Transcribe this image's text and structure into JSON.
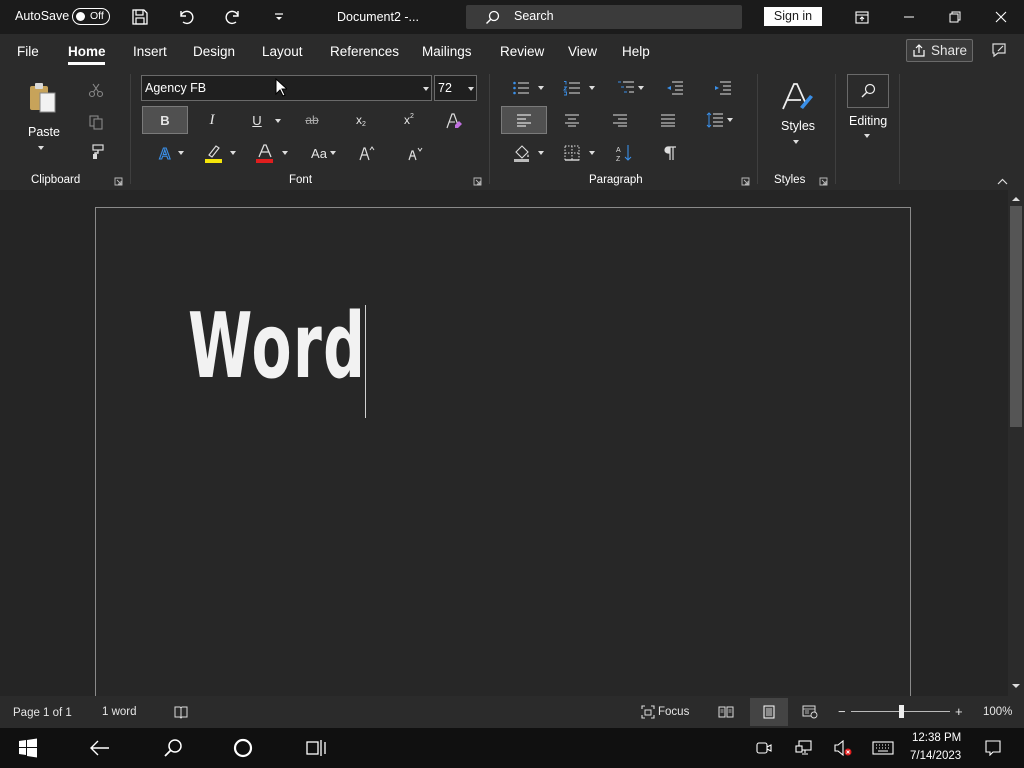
{
  "title_bar": {
    "autosave_label": "AutoSave",
    "autosave_state": "Off",
    "doc_title": "Document2  -...",
    "search_placeholder": "Search",
    "signin_label": "Sign in"
  },
  "menu": {
    "tabs": [
      "File",
      "Home",
      "Insert",
      "Design",
      "Layout",
      "References",
      "Mailings",
      "Review",
      "View",
      "Help"
    ],
    "active_tab": "Home",
    "share_label": "Share"
  },
  "ribbon": {
    "clipboard": {
      "paste_label": "Paste",
      "group_label": "Clipboard"
    },
    "font": {
      "font_name": "Agency FB",
      "font_size": "72",
      "bold": "B",
      "italic": "I",
      "underline": "U",
      "strike": "ab",
      "subscript": "x",
      "superscript": "x",
      "change_case": "Aa",
      "group_label": "Font",
      "highlight_color": "#f5e50a",
      "font_color": "#e01e1e"
    },
    "paragraph": {
      "group_label": "Paragraph"
    },
    "styles": {
      "styles_label": "Styles",
      "group_label": "Styles"
    },
    "editing": {
      "editing_label": "Editing"
    }
  },
  "document": {
    "text": "Word"
  },
  "status_bar": {
    "page": "Page 1 of 1",
    "words": "1 word",
    "focus_label": "Focus",
    "zoom": "100%",
    "zoom_level": 0.5
  },
  "taskbar": {
    "time": "12:38 PM",
    "date": "7/14/2023"
  },
  "colors": {
    "accent": "#ffffff",
    "background": "#1f1f1f",
    "ribbon": "#2b2b2b"
  }
}
